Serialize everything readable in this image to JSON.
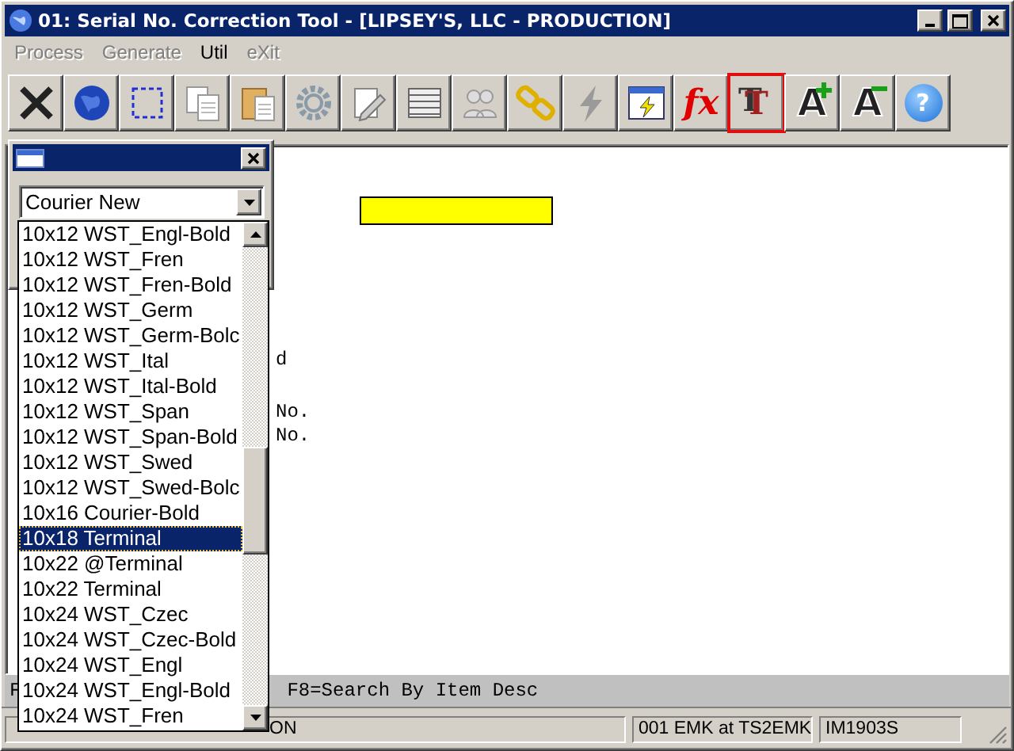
{
  "window": {
    "title": "01: Serial No. Correction Tool - [LIPSEY'S, LLC - PRODUCTION]"
  },
  "menu": [
    {
      "label": "Process",
      "disabled": true
    },
    {
      "label": "Generate",
      "disabled": true
    },
    {
      "label": "Util",
      "disabled": false
    },
    {
      "label": "eXit",
      "disabled": true
    }
  ],
  "toolbar": [
    {
      "kind": "close",
      "selected": false
    },
    {
      "kind": "globe",
      "selected": false
    },
    {
      "kind": "select",
      "selected": false
    },
    {
      "kind": "copy",
      "selected": false
    },
    {
      "kind": "paste",
      "selected": false
    },
    {
      "kind": "gear",
      "selected": false
    },
    {
      "kind": "edit",
      "selected": false
    },
    {
      "kind": "list",
      "selected": false
    },
    {
      "kind": "people",
      "selected": false
    },
    {
      "kind": "link",
      "selected": false
    },
    {
      "kind": "bolt",
      "selected": false
    },
    {
      "kind": "window",
      "selected": false
    },
    {
      "kind": "fx",
      "label": "fx",
      "selected": false
    },
    {
      "kind": "font",
      "label": "T",
      "selected": true
    },
    {
      "kind": "grow",
      "label": "A",
      "selected": false
    },
    {
      "kind": "shrink",
      "label": "A",
      "selected": false
    },
    {
      "kind": "help",
      "label": "?",
      "selected": false
    }
  ],
  "screen_lines": [
    "d",
    "No.",
    "No."
  ],
  "function_bar": [
    "F",
    "F8=Search By Item Desc"
  ],
  "font_window": {
    "combo_value": "Courier New",
    "options": [
      {
        "label": "10x12 WST_Engl-Bold",
        "selected": false
      },
      {
        "label": "10x12 WST_Fren",
        "selected": false
      },
      {
        "label": "10x12 WST_Fren-Bold",
        "selected": false
      },
      {
        "label": "10x12 WST_Germ",
        "selected": false
      },
      {
        "label": "10x12 WST_Germ-Bolc",
        "selected": false
      },
      {
        "label": "10x12 WST_Ital",
        "selected": false
      },
      {
        "label": "10x12 WST_Ital-Bold",
        "selected": false
      },
      {
        "label": "10x12 WST_Span",
        "selected": false
      },
      {
        "label": "10x12 WST_Span-Bold",
        "selected": false
      },
      {
        "label": "10x12 WST_Swed",
        "selected": false
      },
      {
        "label": "10x12 WST_Swed-Bolc",
        "selected": false
      },
      {
        "label": "10x16 Courier-Bold",
        "selected": false
      },
      {
        "label": "10x18 Terminal",
        "selected": true
      },
      {
        "label": "10x22 @Terminal",
        "selected": false
      },
      {
        "label": "10x22 Terminal",
        "selected": false
      },
      {
        "label": "10x24 WST_Czec",
        "selected": false
      },
      {
        "label": "10x24 WST_Czec-Bold",
        "selected": false
      },
      {
        "label": "10x24 WST_Engl",
        "selected": false
      },
      {
        "label": "10x24 WST_Engl-Bold",
        "selected": false
      },
      {
        "label": "10x24 WST_Fren",
        "selected": false
      }
    ]
  },
  "status_bar": [
    "ON",
    "001 EMK at TS2EMK",
    "IM1903S"
  ]
}
